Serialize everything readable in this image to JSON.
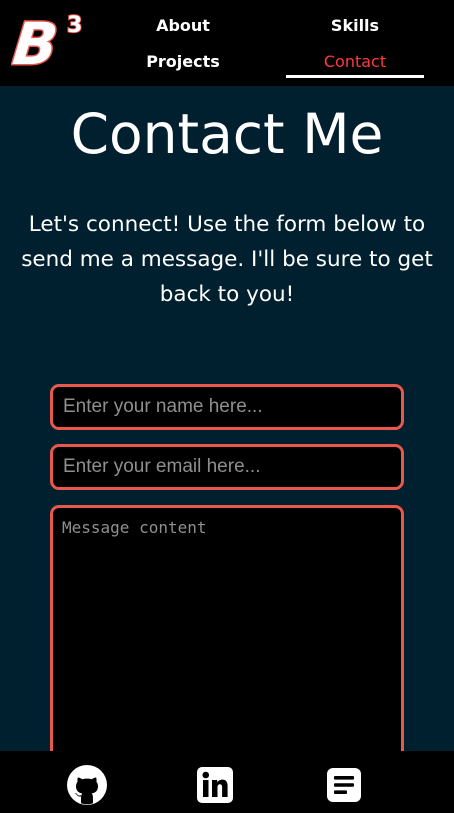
{
  "header": {
    "logo_letter": "B",
    "logo_superscript": "3",
    "nav": {
      "about": "About",
      "skills": "Skills",
      "projects": "Projects",
      "contact": "Contact"
    }
  },
  "main": {
    "title": "Contact Me",
    "intro": "Let's connect! Use the form below to send me a message. I'll be sure to get back to you!",
    "form": {
      "name_placeholder": "Enter your name here...",
      "email_placeholder": "Enter your email here...",
      "message_placeholder": "Message content"
    }
  },
  "footer": {
    "icons": [
      "github-icon",
      "linkedin-icon",
      "resume-icon"
    ]
  },
  "colors": {
    "background": "#01202f",
    "header_footer": "#000000",
    "accent": "#e8584c",
    "active_nav": "#ff3b3b",
    "text": "#ffffff"
  }
}
